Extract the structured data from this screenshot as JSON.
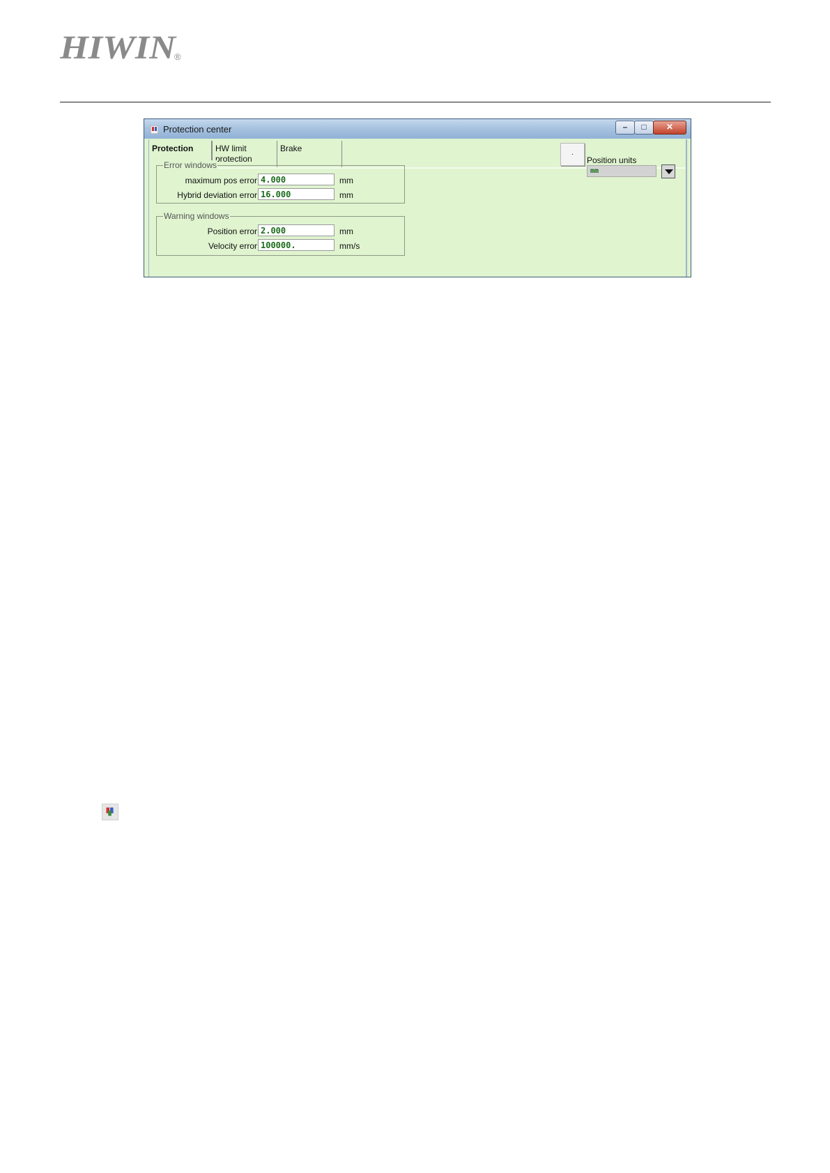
{
  "header": {
    "logo_text": "HIWIN",
    "registered_mark": "®"
  },
  "dialog": {
    "title": "Protection center",
    "window_buttons": {
      "minimize": "–",
      "maximize": "□",
      "close": "✕"
    },
    "tabs": [
      {
        "label": "Protection"
      },
      {
        "label": "HW limit protection"
      },
      {
        "label": "Brake"
      }
    ],
    "dot_button_label": ".",
    "error_windows": {
      "legend": "Error windows",
      "rows": [
        {
          "label": "maximum pos error",
          "value": "4.000",
          "unit": "mm"
        },
        {
          "label": "Hybrid deviation error",
          "value": "16.000",
          "unit": "mm"
        }
      ]
    },
    "warning_windows": {
      "legend": "Warning windows",
      "rows": [
        {
          "label": "Position error",
          "value": "2.000",
          "unit": "mm"
        },
        {
          "label": "Velocity error",
          "value": "100000.",
          "unit": "mm/s"
        }
      ]
    },
    "position_units": {
      "label": "Position units",
      "selected": "mm"
    }
  },
  "icons": {
    "title_icon": "protection-center-icon",
    "body_icon": "protection-center-icon"
  },
  "colors": {
    "client_bg": "#dff4cf",
    "value_text": "#1a6b1a"
  }
}
